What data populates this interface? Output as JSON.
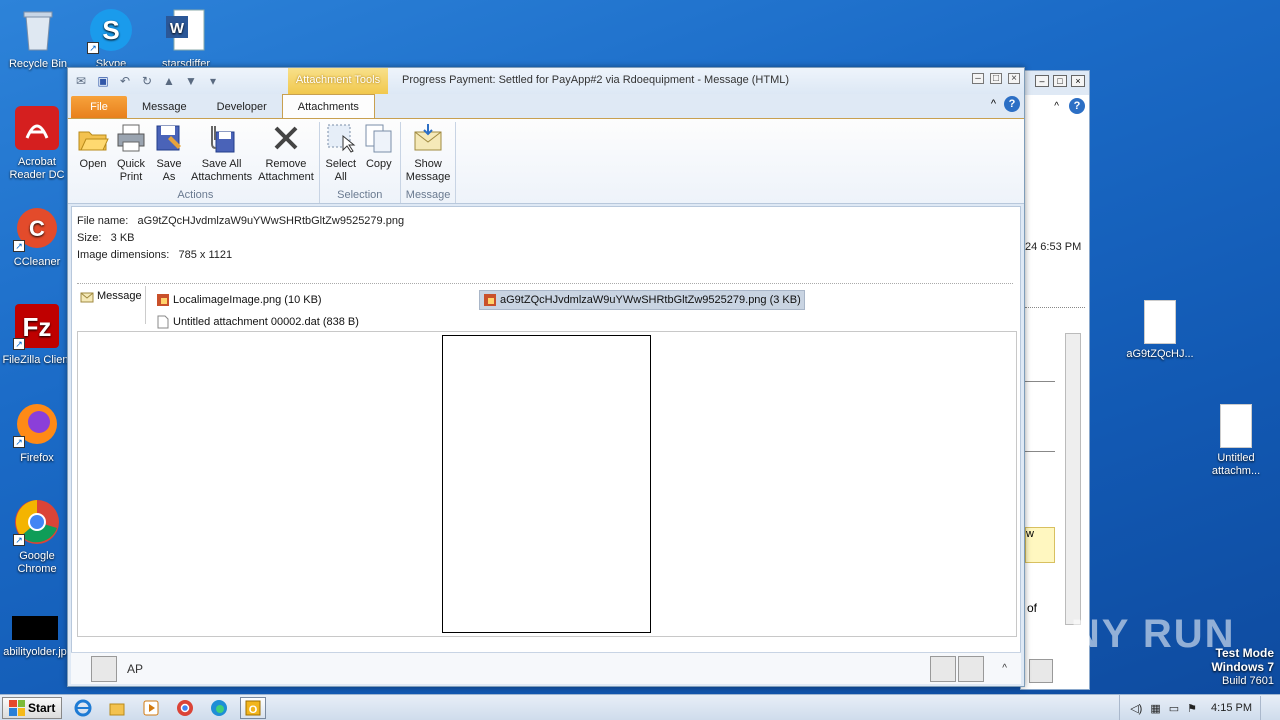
{
  "desktop": {
    "icons_left": [
      {
        "label": "Recycle Bin",
        "icon": "recycle-bin-icon"
      },
      {
        "label": "Skype",
        "icon": "skype-icon"
      },
      {
        "label": "starsdiffer",
        "icon": "word-doc-icon"
      },
      {
        "label": "Acrobat Reader DC",
        "icon": "acrobat-icon"
      },
      {
        "label": "CCleaner",
        "icon": "ccleaner-icon"
      },
      {
        "label": "FileZilla Client",
        "icon": "filezilla-icon"
      },
      {
        "label": "Firefox",
        "icon": "firefox-icon"
      },
      {
        "label": "Google Chrome",
        "icon": "chrome-icon"
      },
      {
        "label": "abilityolder.jp",
        "icon": "image-file-icon"
      }
    ],
    "icons_right": [
      {
        "label": "aG9tZQcHJ...",
        "icon": "png-file-icon"
      },
      {
        "label": "Untitled attachm...",
        "icon": "dat-file-icon"
      }
    ]
  },
  "background_window": {
    "time_text": "24 6:53 PM",
    "fragment_w": "w",
    "fragment_of": "of"
  },
  "window": {
    "context_tab": "Attachment Tools",
    "title": "Progress Payment: Settled for PayApp#2 via Rdoequipment  -  Message (HTML)",
    "tabs": [
      "File",
      "Message",
      "Developer",
      "Attachments"
    ],
    "active_tab": "Attachments"
  },
  "ribbon": {
    "groups": [
      {
        "label": "Actions",
        "buttons": [
          "Open",
          "Quick Print",
          "Save As",
          "Save All Attachments",
          "Remove Attachment"
        ]
      },
      {
        "label": "Selection",
        "buttons": [
          "Select All",
          "Copy"
        ]
      },
      {
        "label": "Message",
        "buttons": [
          "Show Message"
        ]
      }
    ],
    "open": "Open",
    "quick_print_1": "Quick",
    "quick_print_2": "Print",
    "save_as_1": "Save",
    "save_as_2": "As",
    "save_all_1": "Save All",
    "save_all_2": "Attachments",
    "remove_1": "Remove",
    "remove_2": "Attachment",
    "select_all_1": "Select",
    "select_all_2": "All",
    "copy": "Copy",
    "show_message_1": "Show",
    "show_message_2": "Message",
    "group_actions": "Actions",
    "group_selection": "Selection",
    "group_message": "Message"
  },
  "file_info": {
    "name_label": "File name:",
    "name_value": "aG9tZQcHJvdmlzaW9uYWwSHRtbGltZw9525279.png",
    "size_label": "Size:",
    "size_value": "3 KB",
    "dim_label": "Image dimensions:",
    "dim_value": "785 x 1121"
  },
  "attachments": {
    "message_label": "Message",
    "items": [
      {
        "name": "LocalimageImage.png (10 KB)"
      },
      {
        "name": "Untitled attachment 00002.dat (838 B)"
      },
      {
        "name": "aG9tZQcHJvdmlzaW9uYWwSHRtbGltZw9525279.png (3 KB)"
      }
    ]
  },
  "people": {
    "sender": "AP"
  },
  "taskbar": {
    "start": "Start",
    "time": "4:15 PM"
  },
  "watermark": {
    "line1": "Test Mode",
    "line2": "Windows 7",
    "line3": "Build 7601",
    "brand": "ANY RUN"
  }
}
